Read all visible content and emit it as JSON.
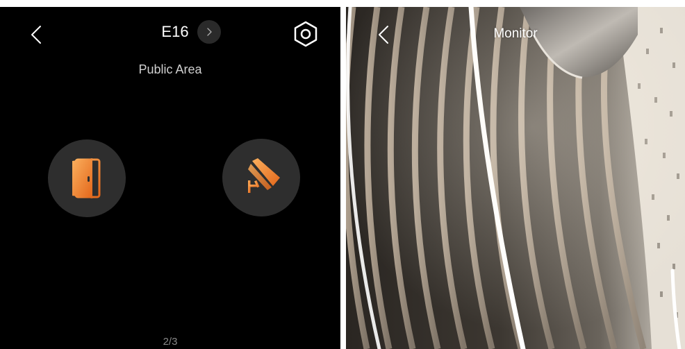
{
  "left_panel": {
    "title": "E16",
    "area": "Public Area",
    "page_indicator": "2/3",
    "icons": {
      "back": "chevron-left-icon",
      "next": "chevron-right-icon",
      "settings": "hexagon-settings-icon",
      "door": "door-open-icon",
      "monitor": "cctv-camera-icon"
    },
    "colors": {
      "accent_start": "#f9a24c",
      "accent_end": "#e8701f",
      "background": "#000000",
      "button_bg": "#2e2e2e"
    }
  },
  "right_panel": {
    "title": "Monitor",
    "icons": {
      "back": "chevron-left-icon"
    }
  }
}
